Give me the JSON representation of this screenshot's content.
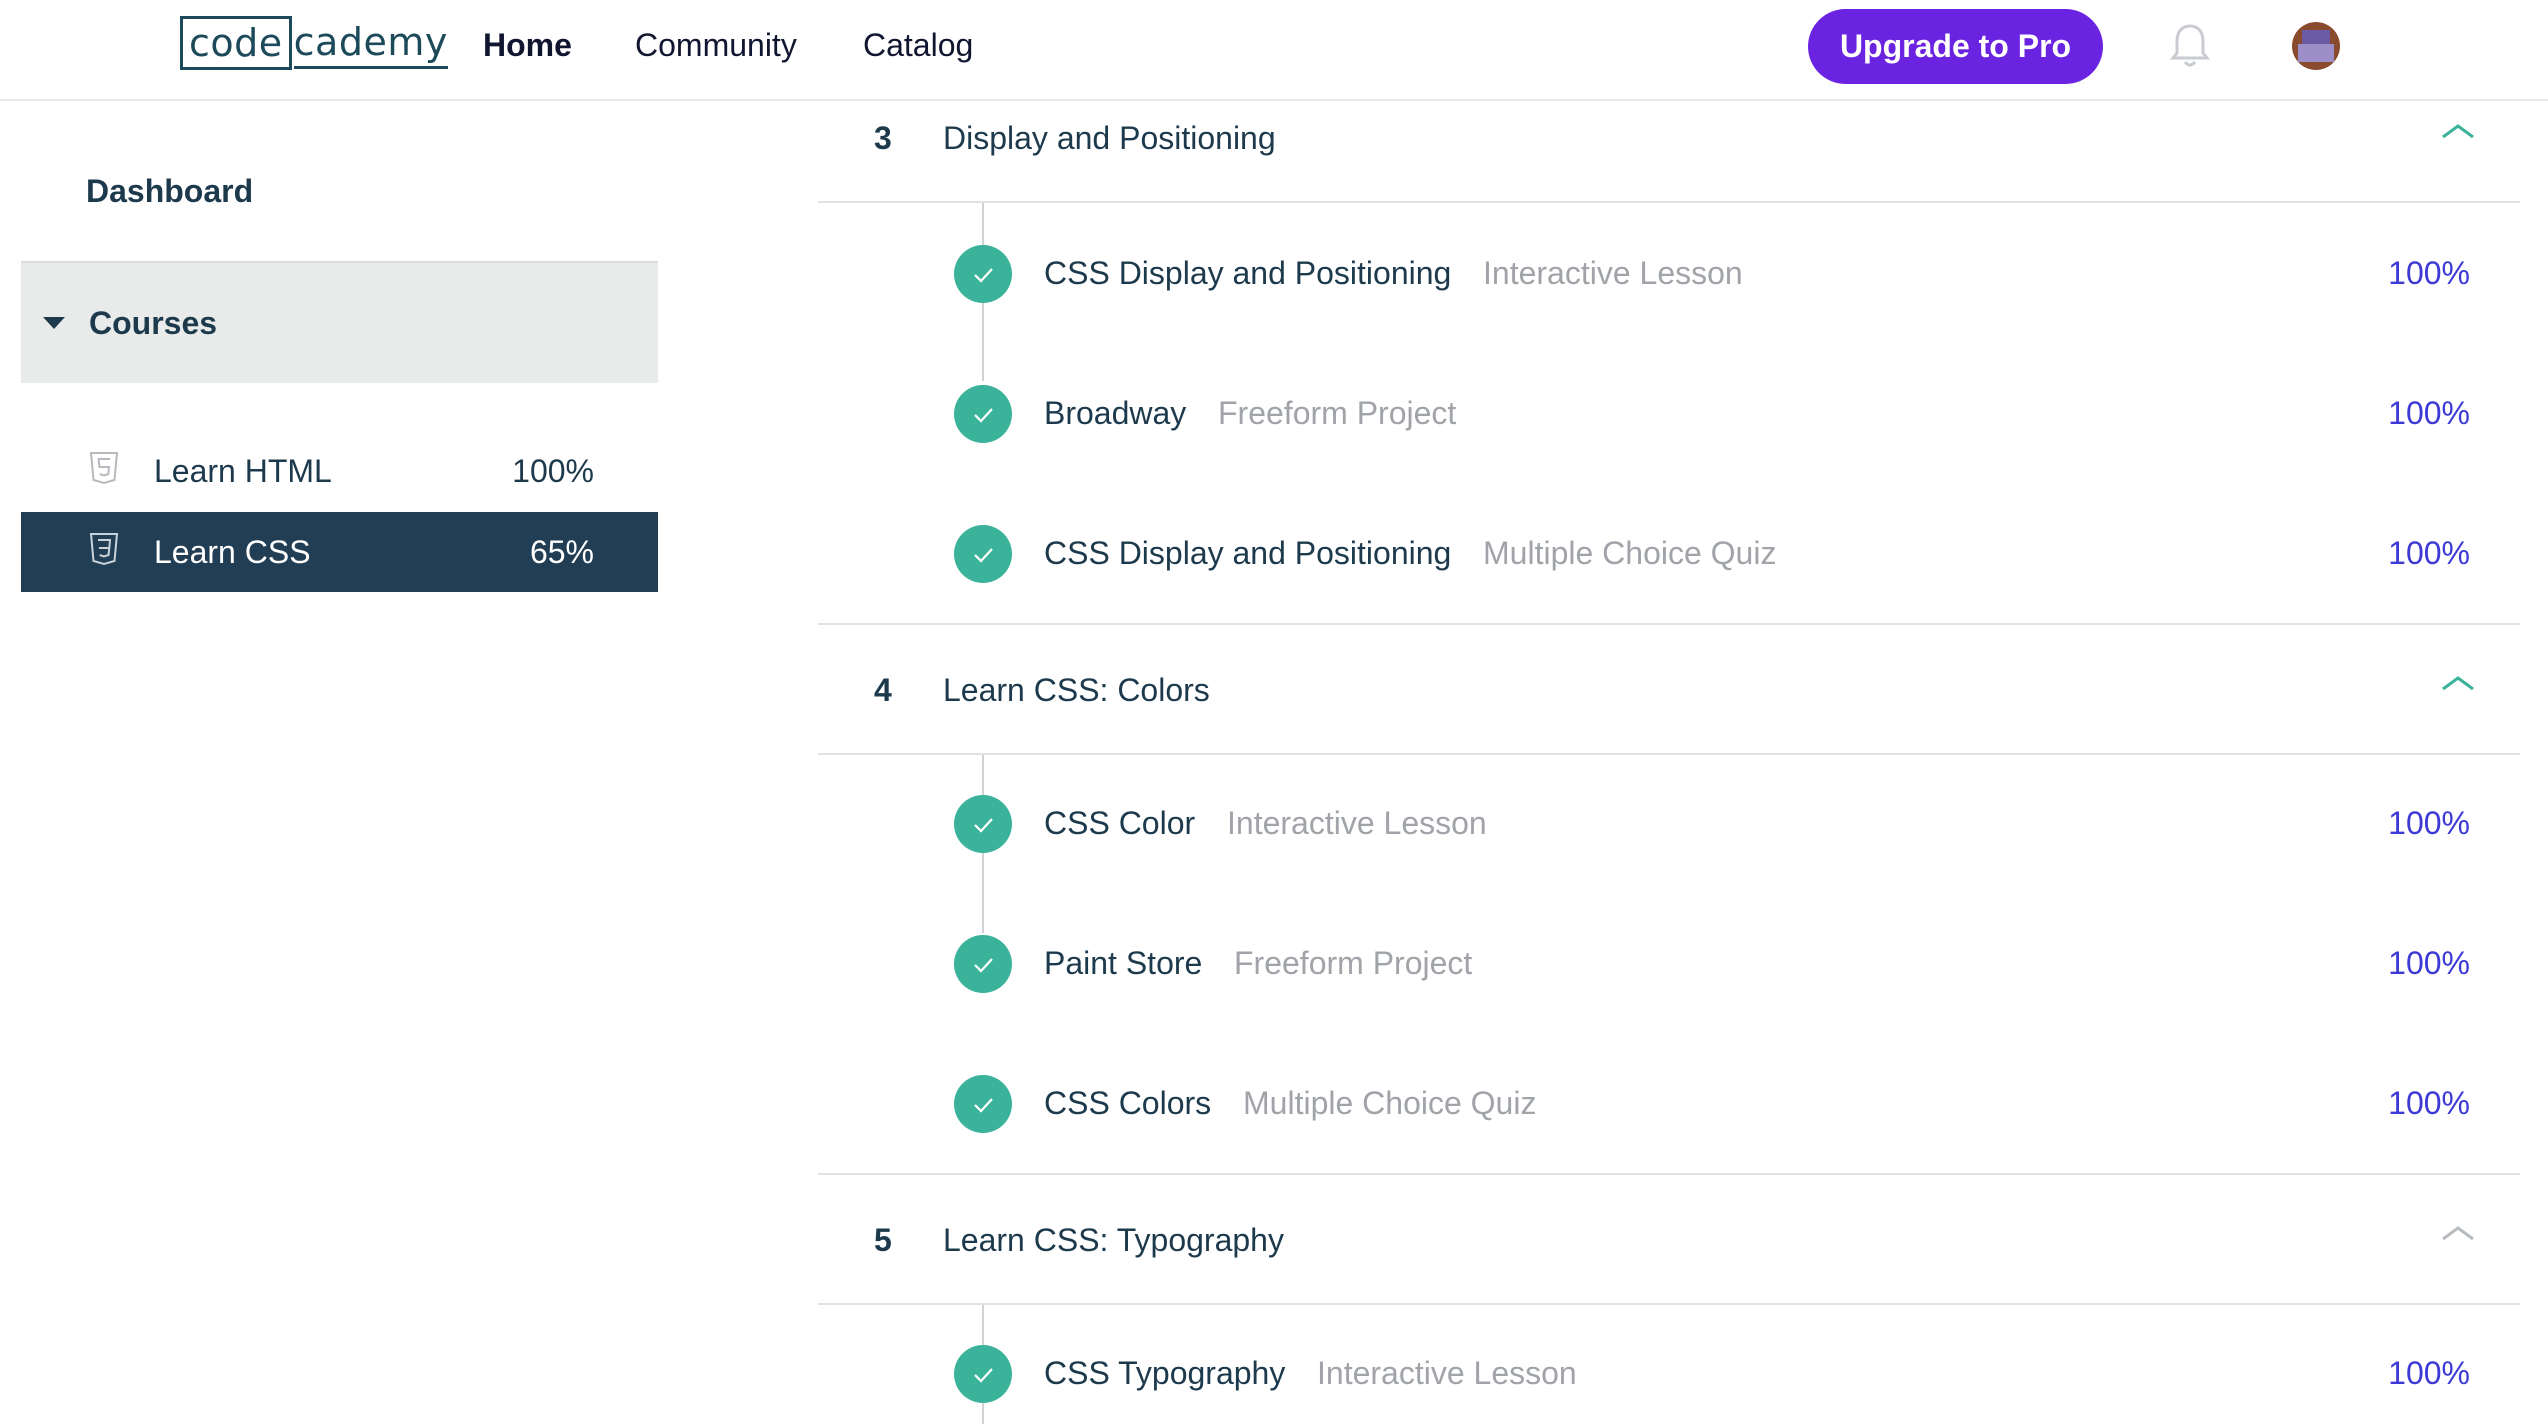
{
  "header": {
    "logo_box": "code",
    "logo_rest": "cademy",
    "nav": [
      {
        "label": "Home"
      },
      {
        "label": "Community"
      },
      {
        "label": "Catalog"
      }
    ],
    "upgrade_label": "Upgrade to Pro",
    "icons": [
      "bell-icon",
      "avatar"
    ]
  },
  "sidebar": {
    "dashboard": "Dashboard",
    "courses_label": "Courses",
    "courses": [
      {
        "name": "Learn HTML",
        "progress": "100%",
        "icon": "html5-icon",
        "active": false
      },
      {
        "name": "Learn CSS",
        "progress": "65%",
        "icon": "css3-icon",
        "active": true
      }
    ]
  },
  "main": {
    "sections": [
      {
        "number": "3",
        "title": "Display and Positioning",
        "expanded": true,
        "items": [
          {
            "name": "CSS Display and Positioning",
            "type": "Interactive Lesson",
            "progress": "100%"
          },
          {
            "name": "Broadway",
            "type": "Freeform Project",
            "progress": "100%"
          },
          {
            "name": "CSS Display and Positioning",
            "type": "Multiple Choice Quiz",
            "progress": "100%"
          }
        ]
      },
      {
        "number": "4",
        "title": "Learn CSS: Colors",
        "expanded": true,
        "items": [
          {
            "name": "CSS Color",
            "type": "Interactive Lesson",
            "progress": "100%"
          },
          {
            "name": "Paint Store",
            "type": "Freeform Project",
            "progress": "100%"
          },
          {
            "name": "CSS Colors",
            "type": "Multiple Choice Quiz",
            "progress": "100%"
          }
        ]
      },
      {
        "number": "5",
        "title": "Learn CSS: Typography",
        "expanded": true,
        "items": [
          {
            "name": "CSS Typography",
            "type": "Interactive Lesson",
            "progress": "100%"
          }
        ]
      }
    ]
  },
  "colors": {
    "brand_purple": "#6a23e0",
    "check_green": "#3bb39a",
    "progress_blue": "#3d3ad6",
    "active_course_bg": "#213e55"
  }
}
